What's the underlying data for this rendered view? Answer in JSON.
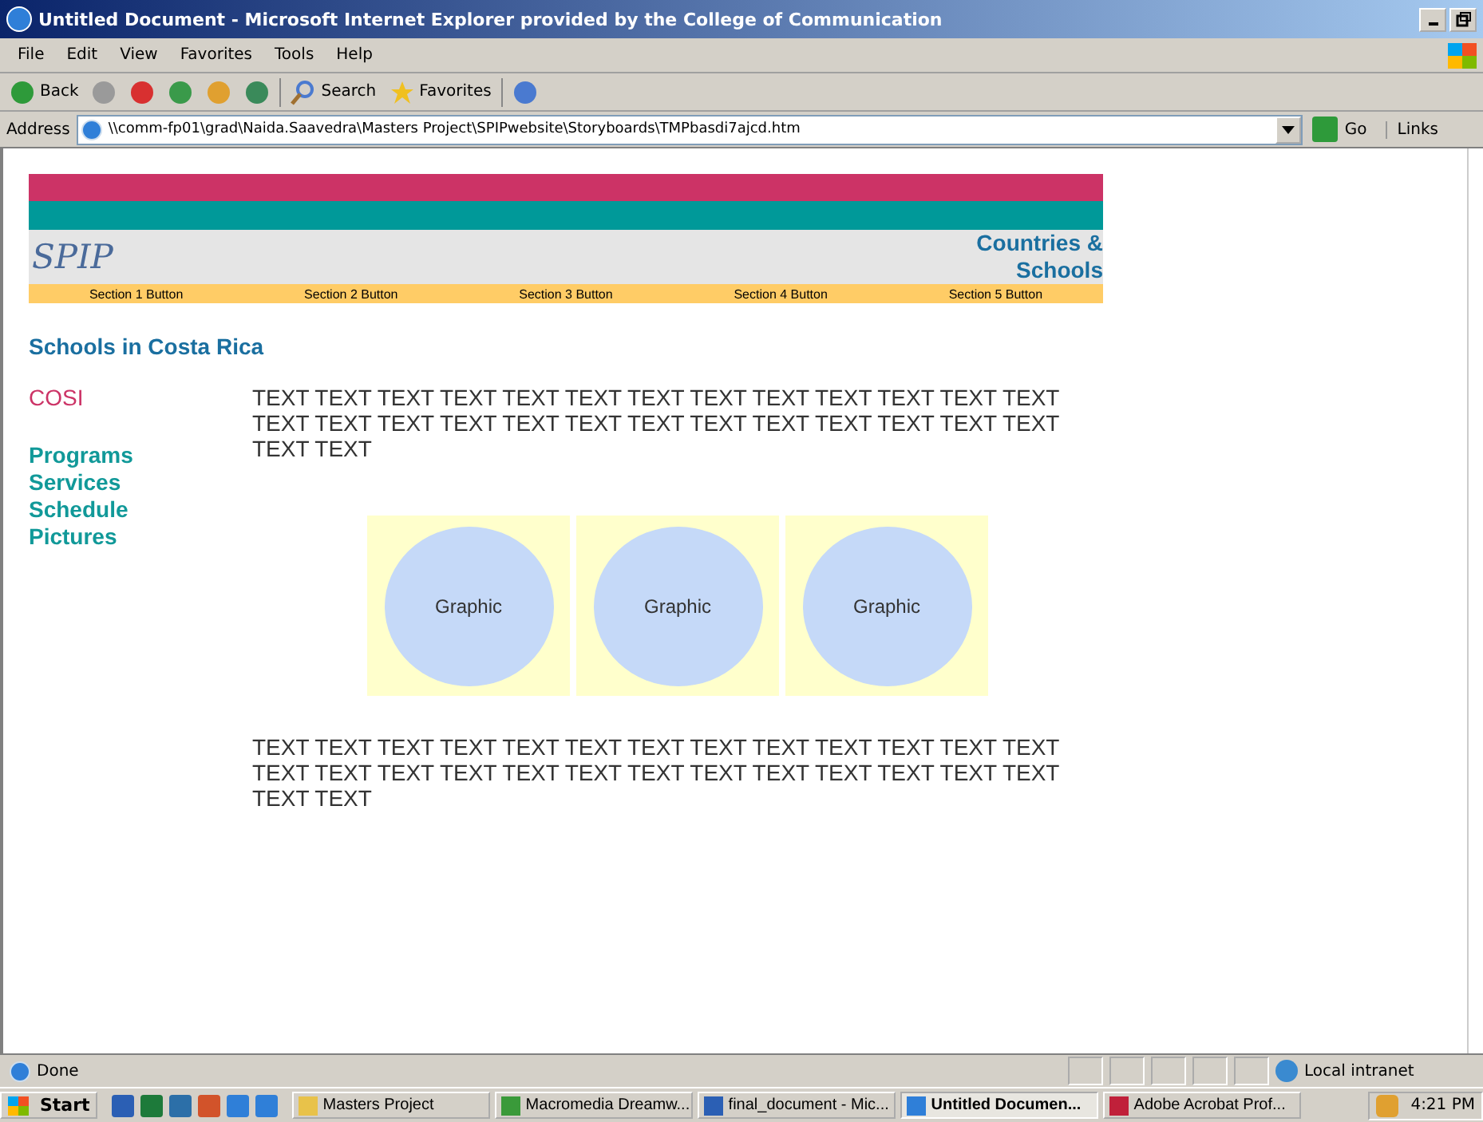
{
  "window": {
    "title": "Untitled Document - Microsoft Internet Explorer provided by the College of Communication"
  },
  "menu": [
    "File",
    "Edit",
    "View",
    "Favorites",
    "Tools",
    "Help"
  ],
  "toolbar": [
    {
      "kind": "back",
      "label": "Back"
    },
    {
      "kind": "forward"
    },
    {
      "kind": "stop"
    },
    {
      "kind": "refresh"
    },
    {
      "kind": "home"
    },
    {
      "kind": "history"
    },
    {
      "kind": "search",
      "label": "Search"
    },
    {
      "kind": "favorites",
      "label": "Favorites"
    },
    {
      "kind": "mail"
    }
  ],
  "address": {
    "label": "Address",
    "value": "\\\\comm-fp01\\grad\\Naida.Saavedra\\Masters Project\\SPIPwebsite\\Storyboards\\TMPbasdi7ajcd.htm",
    "go": "Go",
    "links": "Links"
  },
  "page": {
    "logo": "SPIP",
    "header_link": "Countries & Schools",
    "nav": [
      "Section 1 Button",
      "Section 2 Button",
      "Section 3 Button",
      "Section 4 Button",
      "Section 5 Button"
    ],
    "heading": "Schools in Costa Rica",
    "side": [
      {
        "label": "COSI",
        "selected": true
      },
      {
        "label": "Programs",
        "selected": false
      },
      {
        "label": "Services",
        "selected": false
      },
      {
        "label": "Schedule",
        "selected": false
      },
      {
        "label": "Pictures",
        "selected": false
      }
    ],
    "paragraphs": [
      "TEXT TEXT TEXT TEXT TEXT TEXT TEXT TEXT TEXT TEXT TEXT TEXT TEXT TEXT TEXT TEXT TEXT TEXT TEXT TEXT TEXT TEXT TEXT TEXT TEXT TEXT TEXT TEXT",
      "TEXT TEXT TEXT TEXT TEXT TEXT TEXT TEXT TEXT TEXT TEXT TEXT TEXT TEXT TEXT TEXT TEXT TEXT TEXT TEXT TEXT TEXT TEXT TEXT TEXT TEXT TEXT TEXT"
    ],
    "graphics": [
      "Graphic",
      "Graphic",
      "Graphic"
    ]
  },
  "status": {
    "text": "Done",
    "zone": "Local intranet"
  },
  "taskbar": {
    "start": "Start",
    "quick_launch": [
      {
        "kind": "word"
      },
      {
        "kind": "excel"
      },
      {
        "kind": "publisher"
      },
      {
        "kind": "powerpoint"
      },
      {
        "kind": "ie"
      },
      {
        "kind": "ie"
      }
    ],
    "tasks": [
      {
        "label": "Masters Project",
        "kind": "folder",
        "selected": false
      },
      {
        "label": "Macromedia Dreamw...",
        "kind": "dreamweaver",
        "selected": false
      },
      {
        "label": "final_document - Mic...",
        "kind": "word",
        "selected": false
      },
      {
        "label": "Untitled Documen...",
        "kind": "ie",
        "selected": true
      },
      {
        "label": "Adobe Acrobat Prof...",
        "kind": "acrobat",
        "selected": false
      }
    ],
    "clock": "4:21 PM"
  }
}
